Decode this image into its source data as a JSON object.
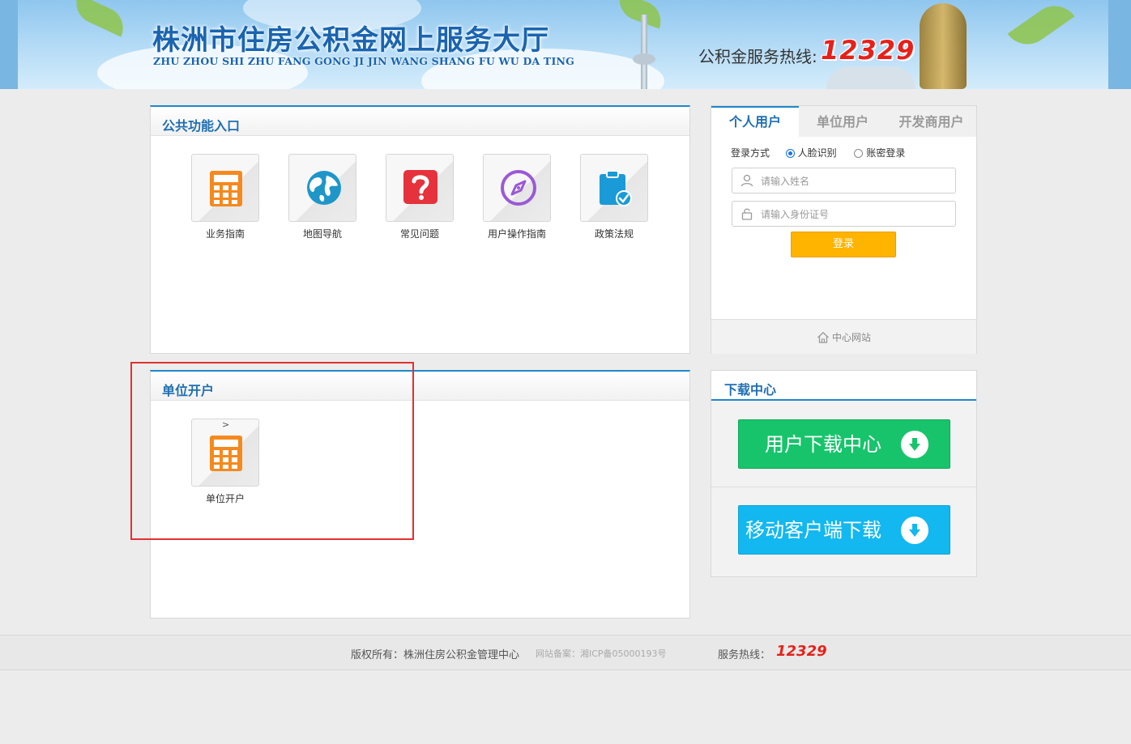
{
  "banner": {
    "title": "株洲市住房公积金网上服务大厅",
    "pinyin": "ZHU ZHOU SHI ZHU FANG GONG JI JIN WANG SHANG FU WU DA TING",
    "hotline_label": "公积金服务热线:",
    "hotline_number": "12329"
  },
  "public_panel": {
    "title": "公共功能入口",
    "tiles": [
      {
        "label": "业务指南",
        "icon": "calculator-icon",
        "color": "#f5891e"
      },
      {
        "label": "地图导航",
        "icon": "globe-icon",
        "color": "#1e96c8"
      },
      {
        "label": "常见问题",
        "icon": "question-icon",
        "color": "#e6323c"
      },
      {
        "label": "用户操作指南",
        "icon": "compass-icon",
        "color": "#9b59d6"
      },
      {
        "label": "政策法规",
        "icon": "clipboard-check-icon",
        "color": "#1a9ad6"
      }
    ]
  },
  "unit_panel": {
    "title": "单位开户",
    "tiles": [
      {
        "label": "单位开户",
        "icon": "calculator-icon",
        "color": "#f5891e",
        "marker": ">"
      }
    ]
  },
  "login": {
    "tabs": [
      "个人用户",
      "单位用户",
      "开发商用户"
    ],
    "active_tab": "个人用户",
    "login_method_label": "登录方式",
    "methods": [
      {
        "label": "人脸识别",
        "selected": true
      },
      {
        "label": "账密登录",
        "selected": false
      }
    ],
    "name_placeholder": "请输入姓名",
    "id_placeholder": "请输入身份证号",
    "submit_label": "登录",
    "center_link": "中心网站"
  },
  "download": {
    "title": "下载中心",
    "user_download": "用户下载中心",
    "mobile_download": "移动客户端下载",
    "green": "#17c46b",
    "blue": "#12b8ef"
  },
  "footer": {
    "copyright": "版权所有：株洲住房公积金管理中心",
    "icp": "网站备案：湘ICP备05000193号",
    "hotline_label": "服务热线：",
    "hotline_number": "12329"
  },
  "colors": {
    "accent": "#1f87c9",
    "title_blue": "#1f6fb2",
    "login_button": "#ffb400",
    "highlight": "#e23030"
  }
}
